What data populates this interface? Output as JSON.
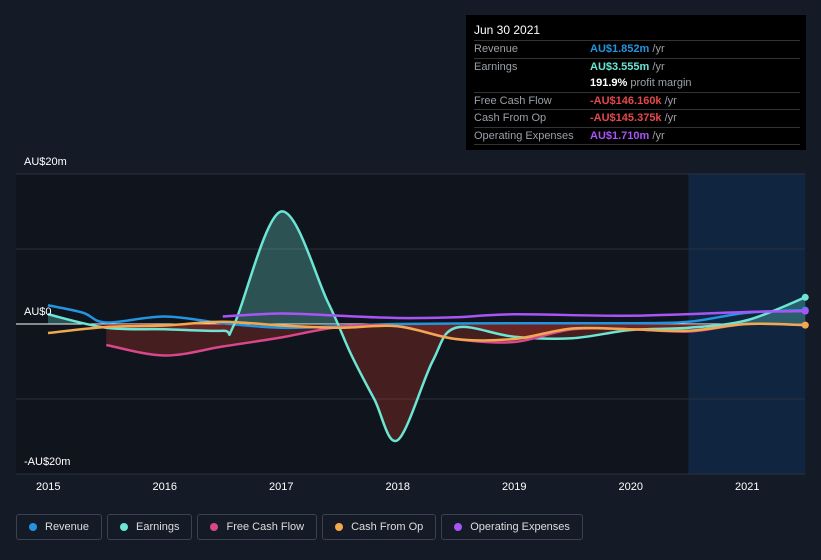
{
  "tooltip": {
    "date": "Jun 30 2021",
    "rows": [
      {
        "label": "Revenue",
        "value": "AU$1.852m",
        "unit": " /yr",
        "color": "#2394df"
      },
      {
        "label": "Earnings",
        "value": "AU$3.555m",
        "unit": " /yr",
        "color": "#6ce5d4"
      },
      {
        "label": "",
        "value": "191.9%",
        "unit": " profit margin",
        "color": "#ffffff"
      },
      {
        "label": "Free Cash Flow",
        "value": "-AU$146.160k",
        "unit": " /yr",
        "color": "#e64848"
      },
      {
        "label": "Cash From Op",
        "value": "-AU$145.375k",
        "unit": " /yr",
        "color": "#e64848"
      },
      {
        "label": "Operating Expenses",
        "value": "AU$1.710m",
        "unit": " /yr",
        "color": "#a855f7"
      }
    ]
  },
  "chart_data": {
    "type": "line",
    "ylabel_ticks": [
      "AU$20m",
      "AU$0",
      "-AU$20m"
    ],
    "ylim": [
      -20,
      20
    ],
    "xlim": [
      2014.85,
      2021.5
    ],
    "x_ticks": [
      "2015",
      "2016",
      "2017",
      "2018",
      "2019",
      "2020",
      "2021"
    ],
    "forecast_region": [
      2020.5,
      2021.5
    ],
    "series": [
      {
        "name": "Revenue",
        "color": "#2394df",
        "points": [
          [
            2015,
            2.5
          ],
          [
            2015.3,
            1.5
          ],
          [
            2015.5,
            0.2
          ],
          [
            2016,
            1
          ],
          [
            2016.5,
            0.1
          ],
          [
            2017,
            -0.5
          ],
          [
            2017.5,
            -0.3
          ],
          [
            2018,
            0
          ],
          [
            2019,
            0.1
          ],
          [
            2020,
            0.1
          ],
          [
            2020.5,
            0.3
          ],
          [
            2021,
            1.5
          ],
          [
            2021.5,
            1.85
          ]
        ]
      },
      {
        "name": "Earnings",
        "color": "#6ce5d4",
        "points": [
          [
            2015,
            1.3
          ],
          [
            2015.5,
            -0.5
          ],
          [
            2016,
            -0.7
          ],
          [
            2016.5,
            -0.9
          ],
          [
            2016.6,
            0
          ],
          [
            2017,
            15
          ],
          [
            2017.4,
            3
          ],
          [
            2017.6,
            -4
          ],
          [
            2017.8,
            -10
          ],
          [
            2018,
            -15.5
          ],
          [
            2018.3,
            -5
          ],
          [
            2018.5,
            -0.5
          ],
          [
            2019,
            -1.7
          ],
          [
            2019.5,
            -1.9
          ],
          [
            2020,
            -0.8
          ],
          [
            2020.5,
            -0.5
          ],
          [
            2021,
            0.5
          ],
          [
            2021.5,
            3.56
          ]
        ]
      },
      {
        "name": "Free Cash Flow",
        "color": "#d9478a",
        "points": [
          [
            2015.5,
            -2.8
          ],
          [
            2016,
            -4.2
          ],
          [
            2016.5,
            -3
          ],
          [
            2017,
            -1.8
          ],
          [
            2017.5,
            -0.4
          ],
          [
            2018,
            -0.3
          ],
          [
            2018.5,
            -2
          ],
          [
            2019,
            -2.4
          ],
          [
            2019.5,
            -0.7
          ],
          [
            2020,
            -0.7
          ],
          [
            2020.5,
            -1
          ],
          [
            2021,
            0
          ],
          [
            2021.5,
            -0.15
          ]
        ]
      },
      {
        "name": "Cash From Op",
        "color": "#f0a94e",
        "points": [
          [
            2015,
            -1.2
          ],
          [
            2015.5,
            -0.4
          ],
          [
            2016,
            -0.2
          ],
          [
            2016.5,
            0.3
          ],
          [
            2017,
            -0.2
          ],
          [
            2017.5,
            -0.5
          ],
          [
            2018,
            -0.3
          ],
          [
            2018.5,
            -2
          ],
          [
            2019,
            -2
          ],
          [
            2019.5,
            -0.6
          ],
          [
            2020,
            -0.7
          ],
          [
            2020.5,
            -0.9
          ],
          [
            2021,
            0
          ],
          [
            2021.5,
            -0.15
          ]
        ]
      },
      {
        "name": "Operating Expenses",
        "color": "#a855f7",
        "points": [
          [
            2016.5,
            1
          ],
          [
            2017,
            1.4
          ],
          [
            2017.5,
            1.1
          ],
          [
            2018,
            0.8
          ],
          [
            2018.5,
            0.9
          ],
          [
            2019,
            1.3
          ],
          [
            2020,
            1.1
          ],
          [
            2021,
            1.6
          ],
          [
            2021.5,
            1.71
          ]
        ]
      }
    ]
  }
}
